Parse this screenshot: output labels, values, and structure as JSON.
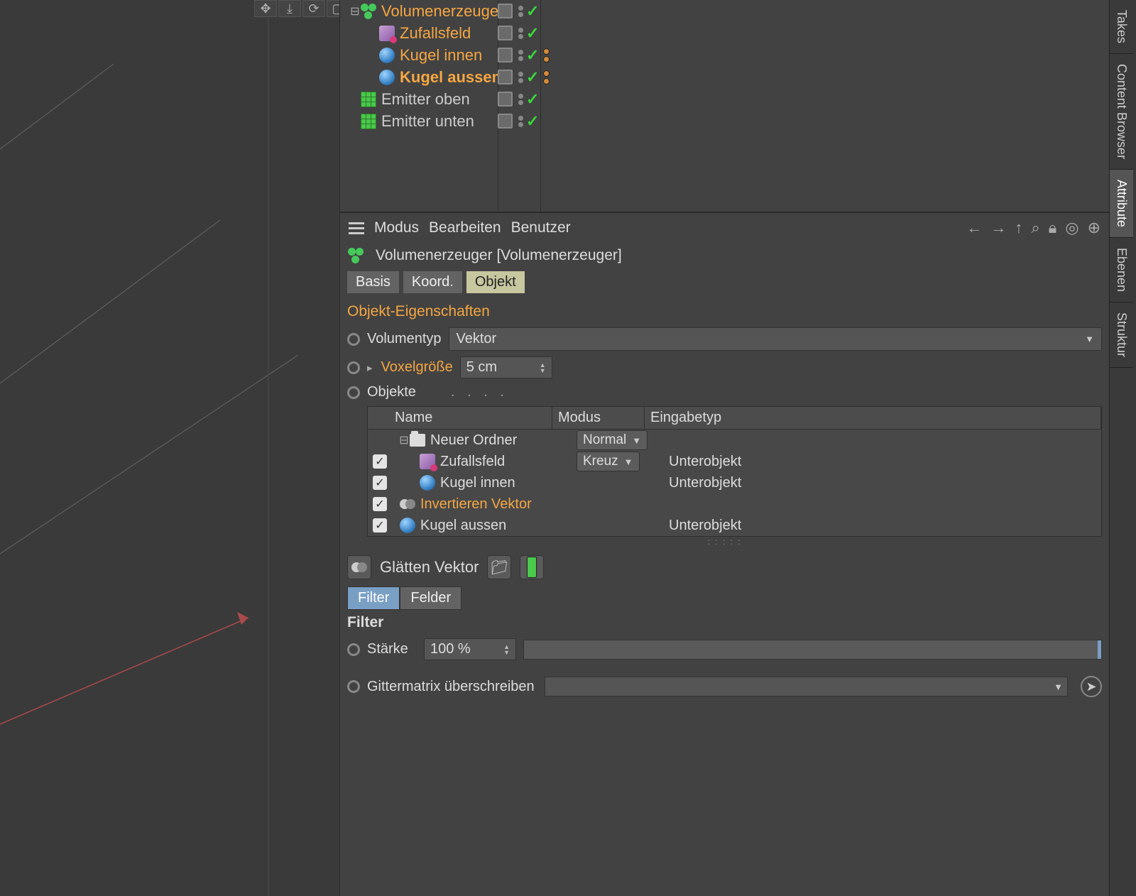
{
  "viewport_icons": [
    "move-icon",
    "down-arrow-icon",
    "rotate-icon",
    "frame-icon"
  ],
  "object_manager": {
    "items": [
      {
        "name": "Volumenerzeuger",
        "icon": "vol",
        "indent": 0,
        "active": true,
        "selected": false,
        "expander": "-",
        "extra": false
      },
      {
        "name": "Zufallsfeld",
        "icon": "rand",
        "indent": 1,
        "active": true,
        "selected": false,
        "expander": "",
        "extra": false
      },
      {
        "name": "Kugel innen",
        "icon": "sphere",
        "indent": 1,
        "active": true,
        "selected": false,
        "expander": "",
        "extra": true
      },
      {
        "name": "Kugel aussen",
        "icon": "sphere",
        "indent": 1,
        "active": true,
        "selected": true,
        "expander": "",
        "extra": true
      },
      {
        "name": "Emitter oben",
        "icon": "emit",
        "indent": 0,
        "active": false,
        "selected": false,
        "expander": "",
        "extra": false
      },
      {
        "name": "Emitter unten",
        "icon": "emit",
        "indent": 0,
        "active": false,
        "selected": false,
        "expander": "",
        "extra": false
      }
    ]
  },
  "sidebar_tabs": [
    "Takes",
    "Content Browser",
    "Attribute",
    "Ebenen",
    "Struktur"
  ],
  "attr": {
    "menu": {
      "modus": "Modus",
      "bearbeiten": "Bearbeiten",
      "benutzer": "Benutzer"
    },
    "title": "Volumenerzeuger [Volumenerzeuger]",
    "tabs": {
      "basis": "Basis",
      "koord": "Koord.",
      "objekt": "Objekt"
    },
    "section": "Objekt-Eigenschaften",
    "volumentyp_label": "Volumentyp",
    "volumentyp_value": "Vektor",
    "voxel_label": "Voxelgröße",
    "voxel_value": "5 cm",
    "objekte_label": "Objekte",
    "table": {
      "headers": {
        "name": "Name",
        "modus": "Modus",
        "eingabetyp": "Eingabetyp"
      },
      "rows": [
        {
          "cb": null,
          "icon": "folder",
          "name": "Neuer Ordner",
          "exp": "-",
          "indent": 0,
          "mode": "Normal",
          "type": "",
          "active": false
        },
        {
          "cb": true,
          "icon": "rand",
          "name": "Zufallsfeld",
          "exp": "",
          "indent": 1,
          "mode": "Kreuz",
          "type": "Unterobjekt",
          "active": false
        },
        {
          "cb": true,
          "icon": "sphere",
          "name": "Kugel innen",
          "exp": "",
          "indent": 1,
          "mode": "",
          "type": "Unterobjekt",
          "active": false
        },
        {
          "cb": true,
          "icon": "invert",
          "name": "Invertieren Vektor",
          "exp": "",
          "indent": 0,
          "mode": "",
          "type": "",
          "active": true
        },
        {
          "cb": true,
          "icon": "sphere",
          "name": "Kugel aussen",
          "exp": "",
          "indent": 0,
          "mode": "",
          "type": "Unterobjekt",
          "active": false
        }
      ]
    },
    "glaetten": "Glätten Vektor",
    "sub_tabs": {
      "filter": "Filter",
      "felder": "Felder"
    },
    "filter_h": "Filter",
    "staerke_label": "Stärke",
    "staerke_value": "100 %",
    "gittermatrix": "Gittermatrix überschreiben"
  }
}
